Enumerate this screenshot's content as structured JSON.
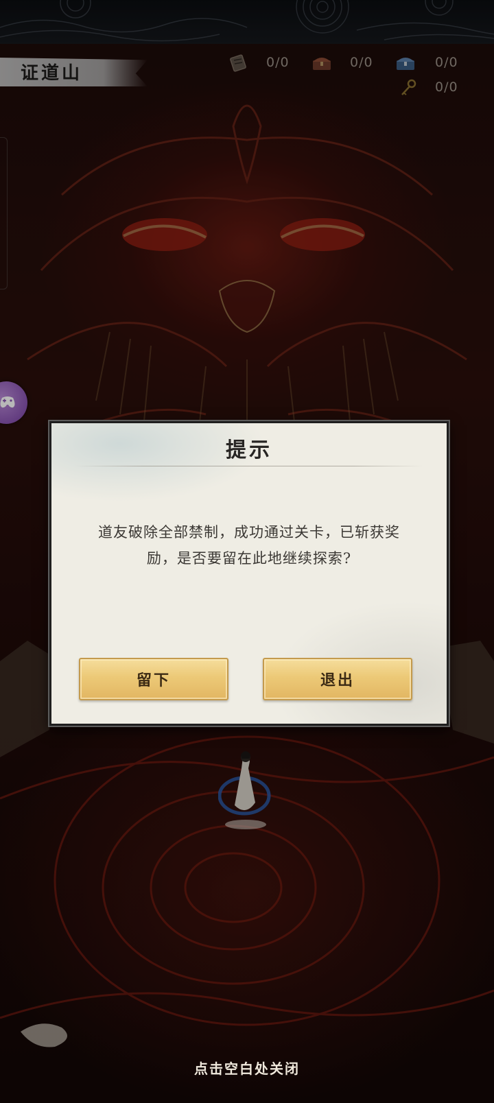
{
  "header": {
    "location_title": "证道山"
  },
  "resources": [
    {
      "icon": "scroll-icon",
      "count": "0/0"
    },
    {
      "icon": "treasure-chest-icon",
      "count": "0/0"
    },
    {
      "icon": "blue-chest-icon",
      "count": "0/0"
    },
    {
      "icon": "key-icon",
      "count": "0/0"
    }
  ],
  "dialog": {
    "title": "提示",
    "message": "道友破除全部禁制，成功通过关卡，已斩获奖励，是否要留在此地继续探索?",
    "stay_label": "留下",
    "exit_label": "退出"
  },
  "footer": {
    "close_hint": "点击空白处关闭"
  },
  "float_button": {
    "icon": "gamepad-icon"
  },
  "colors": {
    "button_gold": "#ecc977",
    "dialog_paper": "#efede4",
    "counter_text": "#9a9187",
    "float_button_purple": "#8a55b2"
  }
}
